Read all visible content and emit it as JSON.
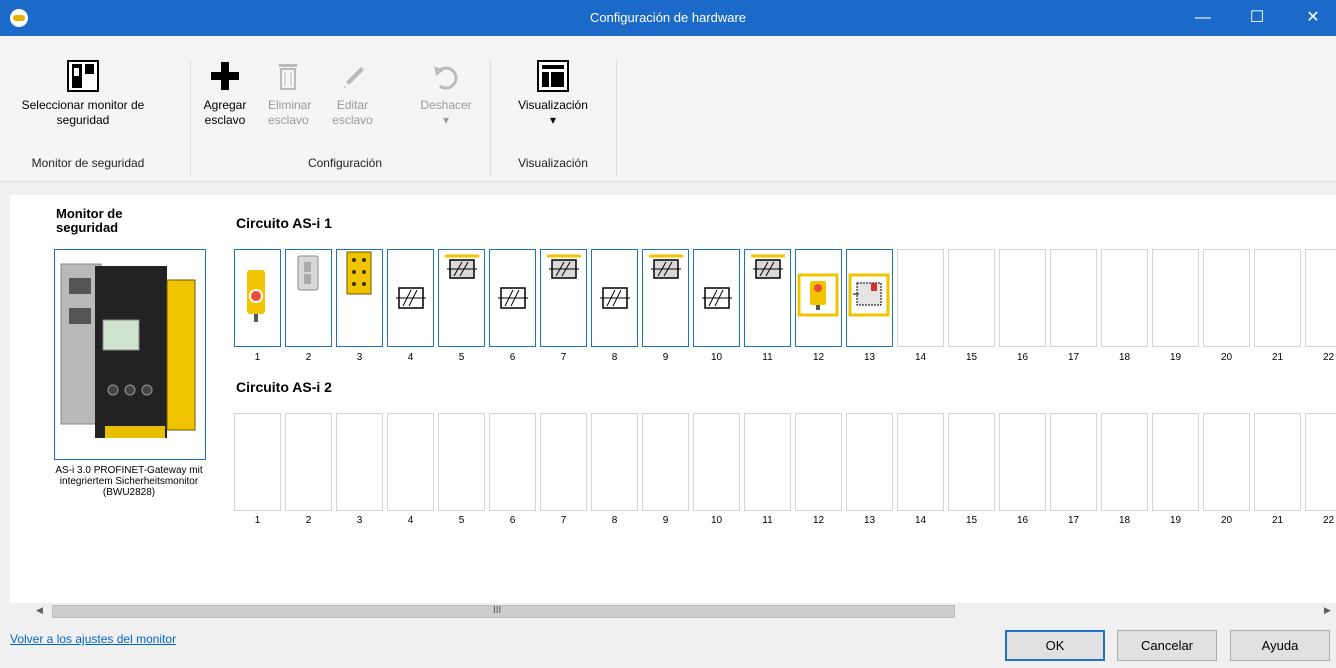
{
  "window": {
    "title": "Configuración de hardware"
  },
  "ribbon": {
    "select_monitor": "Seleccionar monitor de seguridad",
    "add_slave": "Agregar esclavo",
    "delete_slave": "Eliminar esclavo",
    "edit_slave": "Editar esclavo",
    "undo": "Deshacer",
    "view": "Visualización",
    "groups": {
      "monitor": "Monitor de seguridad",
      "config": "Configuración",
      "view": "Visualización"
    }
  },
  "monitor": {
    "title": "Monitor de seguridad",
    "description": "AS-i 3.0 PROFINET-Gateway mit integriertem Sicherheitsmonitor (BWU2828)"
  },
  "circuits": [
    {
      "title": "Circuito AS-i 1",
      "slots": [
        "1",
        "2",
        "3",
        "4",
        "5",
        "6",
        "7",
        "8",
        "9",
        "10",
        "11",
        "12",
        "13",
        "14",
        "15",
        "16",
        "17",
        "18",
        "19",
        "20",
        "21",
        "22"
      ]
    },
    {
      "title": "Circuito AS-i 2",
      "slots": [
        "1",
        "2",
        "3",
        "4",
        "5",
        "6",
        "7",
        "8",
        "9",
        "10",
        "11",
        "12",
        "13",
        "14",
        "15",
        "16",
        "17",
        "18",
        "19",
        "20",
        "21",
        "22"
      ]
    }
  ],
  "footer": {
    "back_link": "Volver a los ajustes del monitor",
    "ok": "OK",
    "cancel": "Cancelar",
    "help": "Ayuda"
  },
  "scroll": {
    "grip": "III",
    "left": "◀",
    "right": "▶"
  },
  "icons": [
    "app-icon",
    "minimize-icon",
    "maximize-icon",
    "close-icon",
    "monitor-select-icon",
    "plus-icon",
    "trash-icon",
    "pencil-icon",
    "undo-icon",
    "view-icon"
  ],
  "colors": {
    "titlebar": "#1b6ac9",
    "slot_border_active": "#1f73c4",
    "module_yellow": "#f5c400"
  }
}
